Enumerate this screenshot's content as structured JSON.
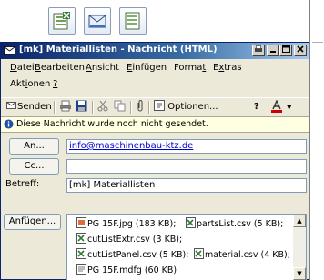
{
  "window": {
    "title": "[mk] Materiallisten - Nachricht (HTML)",
    "title_icon": "envelope-icon",
    "caption_buttons": [
      "printer-icon",
      "minimize-icon",
      "maximize-icon",
      "close-icon"
    ]
  },
  "app_toolbar": {
    "buttons": [
      "excel-icon",
      "mail-icon",
      "document-icon"
    ]
  },
  "menu": {
    "items": [
      "Datei",
      "Bearbeiten",
      "Ansicht",
      "Einfügen",
      "Format",
      "Extras",
      "Aktionen",
      "?"
    ]
  },
  "toolbar": {
    "send_label": "Senden",
    "options_label": "Optionen...",
    "icons": [
      "print-icon",
      "save-icon",
      "cut-icon",
      "copy-icon",
      "attach-icon",
      "options-icon",
      "help-icon",
      "font-color-icon"
    ],
    "font_color": "#cc0000"
  },
  "info": {
    "text": "Diese Nachricht wurde noch nicht gesendet."
  },
  "form": {
    "to_label": "An...",
    "to_value": "info@maschinenbau-ktz.de",
    "cc_label": "Cc...",
    "cc_value": "",
    "subject_label": "Betreff:",
    "subject_value": "[mk] Materiallisten",
    "attach_label": "Anfügen..."
  },
  "attachments": [
    {
      "name": "PG 15F.jpg (183 KB);",
      "icon": "image-file-icon"
    },
    {
      "name": "partsList.csv (5 KB);",
      "icon": "excel-file-icon"
    },
    {
      "name": "cutListExtr.csv (3 KB);",
      "icon": "excel-file-icon"
    },
    {
      "name": "cutListPanel.csv (5 KB);",
      "icon": "excel-file-icon"
    },
    {
      "name": "material.csv (4 KB);",
      "icon": "excel-file-icon"
    },
    {
      "name": "PG 15F.mdfg (60 KB)",
      "icon": "generic-file-icon"
    }
  ]
}
